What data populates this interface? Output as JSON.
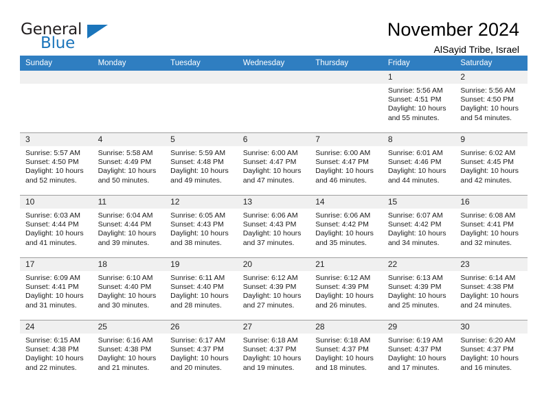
{
  "brand": {
    "name_part1": "General",
    "name_part2": "Blue",
    "triangle_color": "#1b75bb"
  },
  "header": {
    "title": "November 2024",
    "subtitle": "AlSayid Tribe, Israel"
  },
  "theme": {
    "header_row_bg": "#2f7ec1",
    "header_row_text": "#ffffff",
    "daynum_bg": "#f0f0f0",
    "cell_border": "#9e9e9e",
    "page_bg": "#ffffff"
  },
  "labels": {
    "sunrise_prefix": "Sunrise:",
    "sunset_prefix": "Sunset:",
    "daylight_prefix": "Daylight:"
  },
  "weekdays": [
    "Sunday",
    "Monday",
    "Tuesday",
    "Wednesday",
    "Thursday",
    "Friday",
    "Saturday"
  ],
  "weeks": [
    [
      {
        "day": "",
        "blank": true
      },
      {
        "day": "",
        "blank": true
      },
      {
        "day": "",
        "blank": true
      },
      {
        "day": "",
        "blank": true
      },
      {
        "day": "",
        "blank": true
      },
      {
        "day": "1",
        "sunrise": "Sunrise: 5:56 AM",
        "sunset": "Sunset: 4:51 PM",
        "daylight": "Daylight: 10 hours and 55 minutes."
      },
      {
        "day": "2",
        "sunrise": "Sunrise: 5:56 AM",
        "sunset": "Sunset: 4:50 PM",
        "daylight": "Daylight: 10 hours and 54 minutes."
      }
    ],
    [
      {
        "day": "3",
        "sunrise": "Sunrise: 5:57 AM",
        "sunset": "Sunset: 4:50 PM",
        "daylight": "Daylight: 10 hours and 52 minutes."
      },
      {
        "day": "4",
        "sunrise": "Sunrise: 5:58 AM",
        "sunset": "Sunset: 4:49 PM",
        "daylight": "Daylight: 10 hours and 50 minutes."
      },
      {
        "day": "5",
        "sunrise": "Sunrise: 5:59 AM",
        "sunset": "Sunset: 4:48 PM",
        "daylight": "Daylight: 10 hours and 49 minutes."
      },
      {
        "day": "6",
        "sunrise": "Sunrise: 6:00 AM",
        "sunset": "Sunset: 4:47 PM",
        "daylight": "Daylight: 10 hours and 47 minutes."
      },
      {
        "day": "7",
        "sunrise": "Sunrise: 6:00 AM",
        "sunset": "Sunset: 4:47 PM",
        "daylight": "Daylight: 10 hours and 46 minutes."
      },
      {
        "day": "8",
        "sunrise": "Sunrise: 6:01 AM",
        "sunset": "Sunset: 4:46 PM",
        "daylight": "Daylight: 10 hours and 44 minutes."
      },
      {
        "day": "9",
        "sunrise": "Sunrise: 6:02 AM",
        "sunset": "Sunset: 4:45 PM",
        "daylight": "Daylight: 10 hours and 42 minutes."
      }
    ],
    [
      {
        "day": "10",
        "sunrise": "Sunrise: 6:03 AM",
        "sunset": "Sunset: 4:44 PM",
        "daylight": "Daylight: 10 hours and 41 minutes."
      },
      {
        "day": "11",
        "sunrise": "Sunrise: 6:04 AM",
        "sunset": "Sunset: 4:44 PM",
        "daylight": "Daylight: 10 hours and 39 minutes."
      },
      {
        "day": "12",
        "sunrise": "Sunrise: 6:05 AM",
        "sunset": "Sunset: 4:43 PM",
        "daylight": "Daylight: 10 hours and 38 minutes."
      },
      {
        "day": "13",
        "sunrise": "Sunrise: 6:06 AM",
        "sunset": "Sunset: 4:43 PM",
        "daylight": "Daylight: 10 hours and 37 minutes."
      },
      {
        "day": "14",
        "sunrise": "Sunrise: 6:06 AM",
        "sunset": "Sunset: 4:42 PM",
        "daylight": "Daylight: 10 hours and 35 minutes."
      },
      {
        "day": "15",
        "sunrise": "Sunrise: 6:07 AM",
        "sunset": "Sunset: 4:42 PM",
        "daylight": "Daylight: 10 hours and 34 minutes."
      },
      {
        "day": "16",
        "sunrise": "Sunrise: 6:08 AM",
        "sunset": "Sunset: 4:41 PM",
        "daylight": "Daylight: 10 hours and 32 minutes."
      }
    ],
    [
      {
        "day": "17",
        "sunrise": "Sunrise: 6:09 AM",
        "sunset": "Sunset: 4:41 PM",
        "daylight": "Daylight: 10 hours and 31 minutes."
      },
      {
        "day": "18",
        "sunrise": "Sunrise: 6:10 AM",
        "sunset": "Sunset: 4:40 PM",
        "daylight": "Daylight: 10 hours and 30 minutes."
      },
      {
        "day": "19",
        "sunrise": "Sunrise: 6:11 AM",
        "sunset": "Sunset: 4:40 PM",
        "daylight": "Daylight: 10 hours and 28 minutes."
      },
      {
        "day": "20",
        "sunrise": "Sunrise: 6:12 AM",
        "sunset": "Sunset: 4:39 PM",
        "daylight": "Daylight: 10 hours and 27 minutes."
      },
      {
        "day": "21",
        "sunrise": "Sunrise: 6:12 AM",
        "sunset": "Sunset: 4:39 PM",
        "daylight": "Daylight: 10 hours and 26 minutes."
      },
      {
        "day": "22",
        "sunrise": "Sunrise: 6:13 AM",
        "sunset": "Sunset: 4:39 PM",
        "daylight": "Daylight: 10 hours and 25 minutes."
      },
      {
        "day": "23",
        "sunrise": "Sunrise: 6:14 AM",
        "sunset": "Sunset: 4:38 PM",
        "daylight": "Daylight: 10 hours and 24 minutes."
      }
    ],
    [
      {
        "day": "24",
        "sunrise": "Sunrise: 6:15 AM",
        "sunset": "Sunset: 4:38 PM",
        "daylight": "Daylight: 10 hours and 22 minutes."
      },
      {
        "day": "25",
        "sunrise": "Sunrise: 6:16 AM",
        "sunset": "Sunset: 4:38 PM",
        "daylight": "Daylight: 10 hours and 21 minutes."
      },
      {
        "day": "26",
        "sunrise": "Sunrise: 6:17 AM",
        "sunset": "Sunset: 4:37 PM",
        "daylight": "Daylight: 10 hours and 20 minutes."
      },
      {
        "day": "27",
        "sunrise": "Sunrise: 6:18 AM",
        "sunset": "Sunset: 4:37 PM",
        "daylight": "Daylight: 10 hours and 19 minutes."
      },
      {
        "day": "28",
        "sunrise": "Sunrise: 6:18 AM",
        "sunset": "Sunset: 4:37 PM",
        "daylight": "Daylight: 10 hours and 18 minutes."
      },
      {
        "day": "29",
        "sunrise": "Sunrise: 6:19 AM",
        "sunset": "Sunset: 4:37 PM",
        "daylight": "Daylight: 10 hours and 17 minutes."
      },
      {
        "day": "30",
        "sunrise": "Sunrise: 6:20 AM",
        "sunset": "Sunset: 4:37 PM",
        "daylight": "Daylight: 10 hours and 16 minutes."
      }
    ]
  ]
}
